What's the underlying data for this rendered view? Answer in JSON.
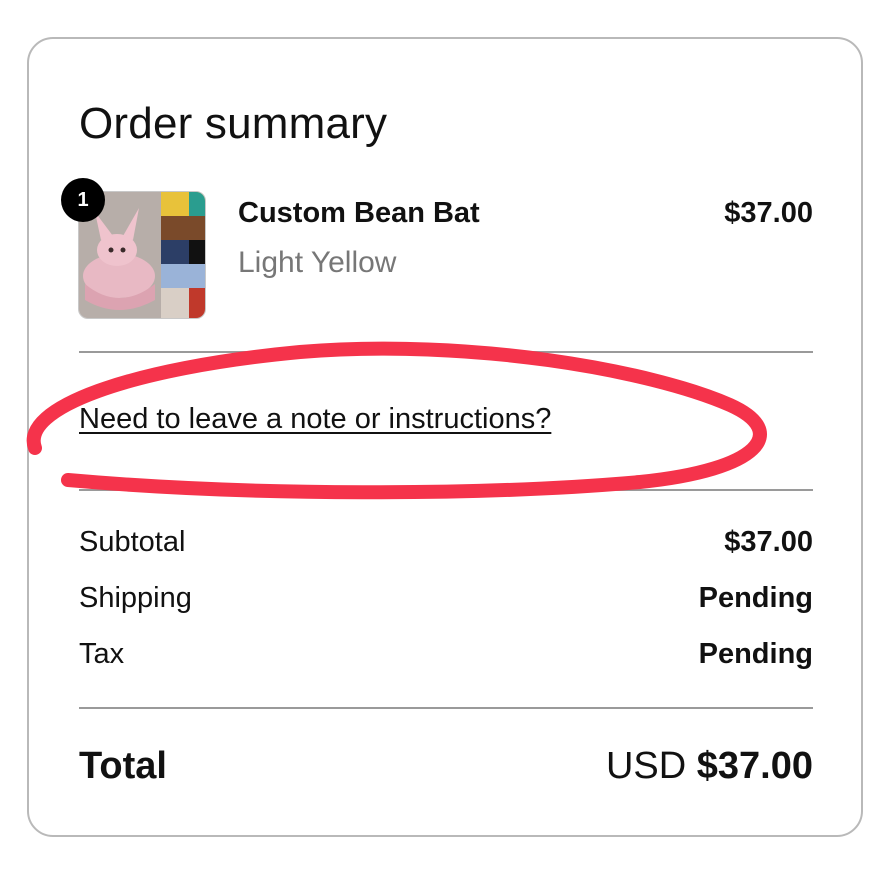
{
  "summary": {
    "title": "Order summary"
  },
  "item": {
    "quantity": "1",
    "name": "Custom Bean Bat",
    "variant": "Light Yellow",
    "price": "$37.00"
  },
  "note": {
    "link_label": "Need to leave a note or instructions?"
  },
  "costs": {
    "subtotal_label": "Subtotal",
    "subtotal_value": "$37.00",
    "shipping_label": "Shipping",
    "shipping_value": "Pending",
    "tax_label": "Tax",
    "tax_value": "Pending"
  },
  "total": {
    "label": "Total",
    "currency": "USD",
    "amount": "$37.00"
  },
  "colors": {
    "annotation_stroke": "#f5334b",
    "badge": "#000000",
    "muted_text": "#777777"
  }
}
